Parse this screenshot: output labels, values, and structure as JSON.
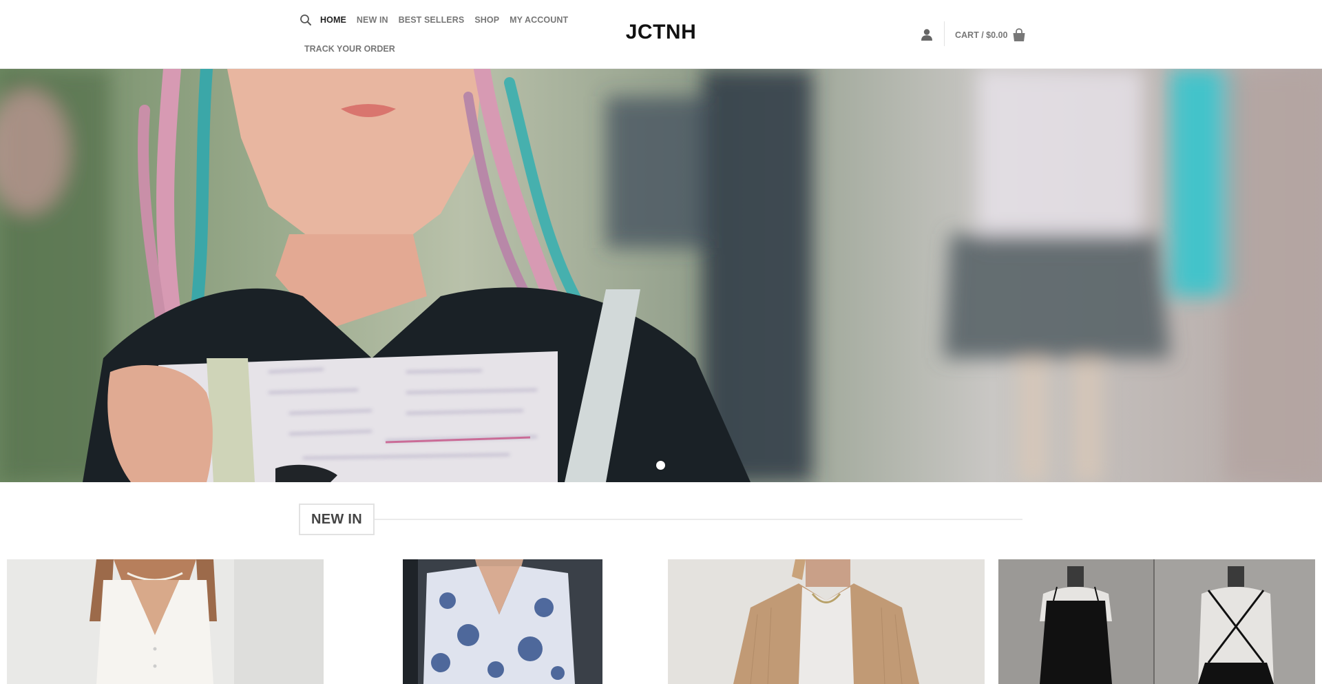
{
  "header": {
    "nav": [
      "HOME",
      "NEW IN",
      "BEST SELLERS",
      "SHOP",
      "MY ACCOUNT"
    ],
    "nav_row2": "TRACK YOUR ORDER",
    "logo": "JCTNH",
    "cart_label": "CART / $0.00",
    "icons": [
      "search-icon",
      "user-icon",
      "shopping-bag-icon"
    ]
  },
  "hero": {
    "slides_total": 1,
    "active_slide": 1
  },
  "section": {
    "title": "NEW IN"
  },
  "products": [
    {
      "image": "white-vest-top"
    },
    {
      "image": "blue-floral-blouse"
    },
    {
      "image": "beige-shirt-jacket"
    },
    {
      "image": "black-lace-up-dress"
    }
  ],
  "colors": {
    "text_dark": "#222222",
    "text_nav": "#777777",
    "border": "#e2e2e2"
  }
}
